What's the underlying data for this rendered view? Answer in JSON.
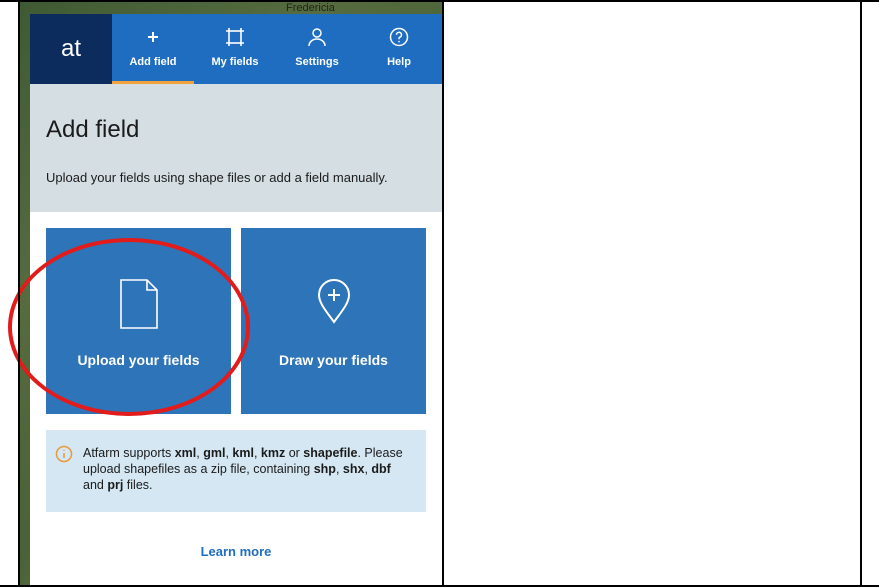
{
  "map": {
    "place_label": "Fredericia"
  },
  "app": {
    "logo_text": "at"
  },
  "nav": {
    "items": [
      {
        "label": "Add field",
        "icon": "plus-icon",
        "active": true
      },
      {
        "label": "My fields",
        "icon": "field-frame-icon",
        "active": false
      },
      {
        "label": "Settings",
        "icon": "user-icon",
        "active": false
      },
      {
        "label": "Help",
        "icon": "help-icon",
        "active": false
      }
    ]
  },
  "page": {
    "title": "Add field",
    "subtitle": "Upload your fields using shape files or add a field manually."
  },
  "cards": {
    "upload": {
      "label": "Upload your fields",
      "icon": "document-icon"
    },
    "draw": {
      "label": "Draw your fields",
      "icon": "map-pin-plus-icon"
    }
  },
  "info": {
    "icon": "info-icon",
    "text_parts": [
      "Atfarm supports ",
      "xml",
      ", ",
      "gml",
      ", ",
      "kml",
      ", ",
      "kmz",
      " or ",
      "shapefile",
      ".",
      " Please upload shapefiles as a zip file, containing ",
      "shp",
      ", ",
      "shx",
      ", ",
      "dbf",
      " and ",
      "prj",
      " files."
    ]
  },
  "links": {
    "learn_more": "Learn more"
  },
  "colors": {
    "nav_bg": "#1e6dc0",
    "logo_bg": "#0c2c5e",
    "active_indicator": "#f0a23c",
    "card_bg": "#2e74b8",
    "info_bg": "#d4e7f3",
    "header_bg": "#d5dee3",
    "highlight_circle": "#e21b1b"
  }
}
